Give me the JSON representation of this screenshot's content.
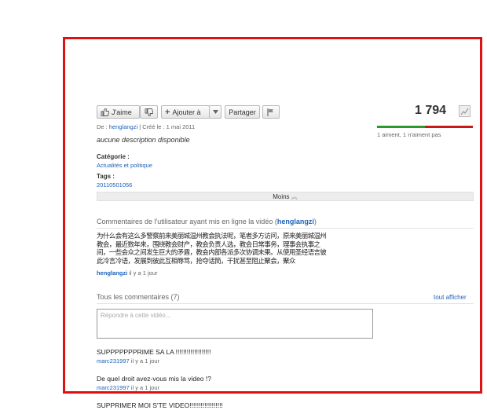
{
  "actions": {
    "like_label": "J'aime",
    "add_to_label": "Ajouter à",
    "share_label": "Partager",
    "views": "1 794"
  },
  "ratings_text": "1 aiment, 1 n'aiment pas",
  "ratings": {
    "likes": 1,
    "dislikes": 1
  },
  "uploader_line": {
    "prefix": "De : ",
    "user": "henglangzi",
    "created": " | Créé le : 1 mai 2011"
  },
  "description": "aucune description disponible",
  "category": {
    "label": "Catégorie :",
    "value": "Actualités et politique"
  },
  "tags": {
    "label": "Tags :",
    "value": "20110501056"
  },
  "less_button": "Moins",
  "uploader_comments": {
    "heading_prefix": "Commentaires de l'utilisateur ayant mis en ligne la vidéo (",
    "heading_user": "henglangzi",
    "heading_suffix": ")",
    "lines": [
      "为什么会有这么多警察前来美丽城温州教会执法呢，笔者多方访问，原来美丽城温州",
      "教会，最近数年来，围绕教会财产，教会负责人选，教会日常事务，理事会执事之",
      "间，一些会众之间发生巨大的矛盾，教会内部各派多次协调未果。从使用圣经语言彼",
      "此冷言冷语，发展到彼此互相辱骂，抢夺话筒，干扰甚至阻止聚会，聚众"
    ],
    "author": "henglangzi",
    "time": " il y a 1 jour"
  },
  "all_comments": {
    "heading": "Tous les commentaires (7)",
    "show_all": "tout afficher",
    "reply_placeholder": "Répondre à cette vidéo...",
    "items": [
      {
        "text": "SUPPPPPPPRIME SA LA !!!!!!!!!!!!!!!!!!!",
        "author": "marc231997",
        "time": " il y a 1 jour"
      },
      {
        "text": "De quel droit avez-vous mis la video !?",
        "author": "marc231997",
        "time": " il y a 1 jour"
      },
      {
        "text": "SUPPRIMER MOI S'TE VIDEO!!!!!!!!!!!!!!!!!!",
        "author": "",
        "time": ""
      }
    ]
  },
  "colors": {
    "frame": "#e01010",
    "like_bar": "#2a9a2a",
    "dislike_bar": "#c81818",
    "link": "#1c62b9"
  }
}
